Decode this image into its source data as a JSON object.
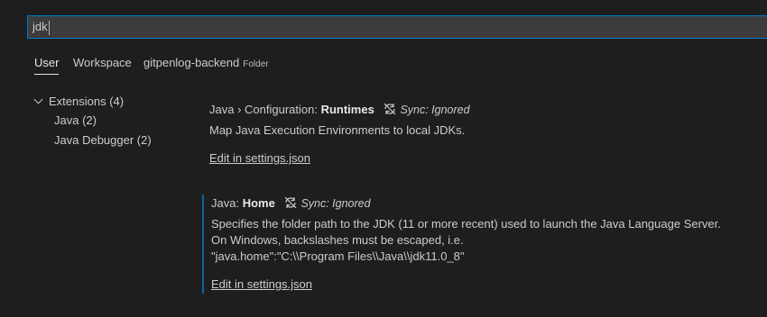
{
  "search": {
    "value": "jdk"
  },
  "tabs": [
    {
      "label": "User"
    },
    {
      "label": "Workspace"
    },
    {
      "label": "gitpenlog-backend",
      "tag": "Folder"
    }
  ],
  "toc": {
    "group": {
      "label": "Extensions (4)"
    },
    "items": [
      {
        "label": "Java (2)"
      },
      {
        "label": "Java Debugger (2)"
      }
    ]
  },
  "settings": [
    {
      "category": "Java › Configuration: ",
      "key": "Runtimes",
      "sync": "Sync: Ignored",
      "description": [
        "Map Java Execution Environments to local JDKs."
      ],
      "edit_label": "Edit in settings.json"
    },
    {
      "category": "Java: ",
      "key": "Home",
      "sync": "Sync: Ignored",
      "description": [
        "Specifies the folder path to the JDK (11 or more recent) used to launch the Java Language Server.",
        "On Windows, backslashes must be escaped, i.e.",
        "\"java.home\":\"C:\\\\Program Files\\\\Java\\\\jdk11.0_8\""
      ],
      "edit_label": "Edit in settings.json"
    }
  ],
  "colors": {
    "focus_border": "#007acc",
    "focused_setting_bar": "#0e639c",
    "background": "#1e1e1e"
  },
  "icons": {
    "sync_ignored": "sync-ignored-icon",
    "chevron": "chevron-down-icon"
  }
}
